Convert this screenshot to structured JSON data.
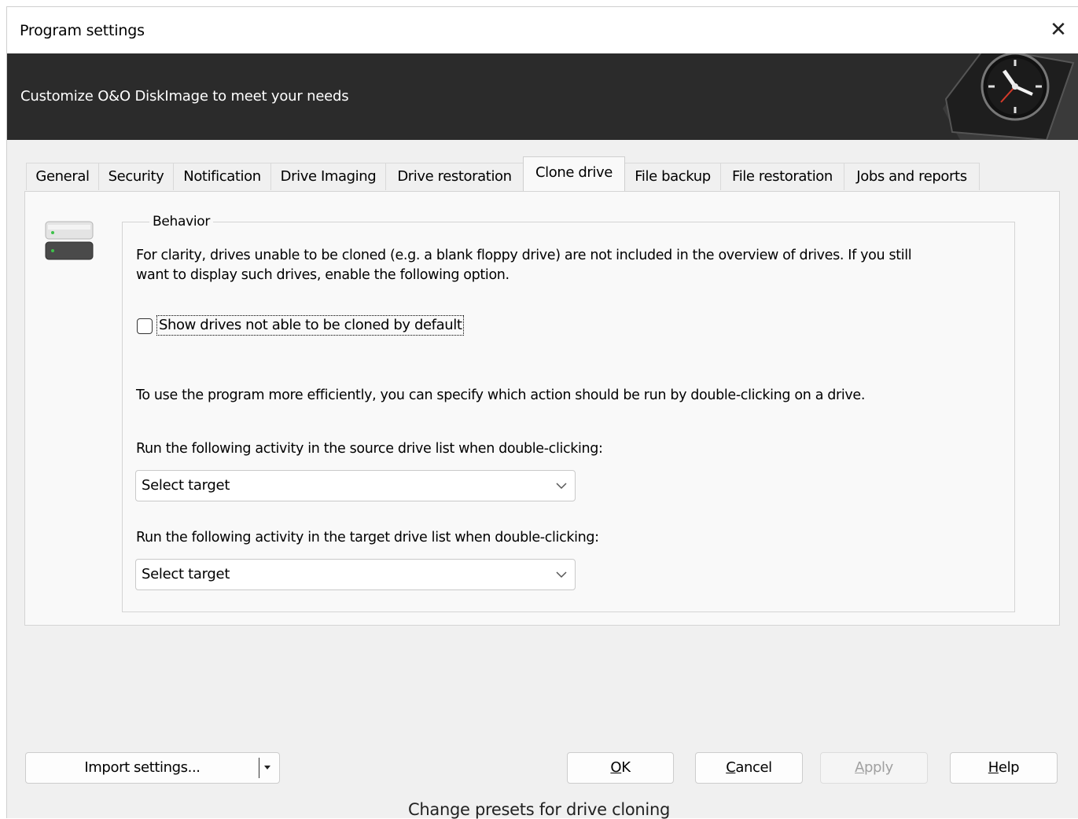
{
  "window": {
    "title": "Program settings",
    "close_glyph": "✕",
    "banner_text": "Customize O&O DiskImage to meet your needs"
  },
  "tabs": [
    {
      "label": "General",
      "active": false
    },
    {
      "label": "Security",
      "active": false
    },
    {
      "label": "Notification",
      "active": false
    },
    {
      "label": "Drive Imaging",
      "active": false
    },
    {
      "label": "Drive restoration",
      "active": false
    },
    {
      "label": "Clone drive",
      "active": true
    },
    {
      "label": "File backup",
      "active": false
    },
    {
      "label": "File restoration",
      "active": false
    },
    {
      "label": "Jobs and reports",
      "active": false
    }
  ],
  "behavior": {
    "legend": "Behavior",
    "info_line1": "For clarity, drives unable to be cloned (e.g. a blank floppy drive) are not included in the overview of drives. If you still",
    "info_line2": "want to display such drives, enable the following option.",
    "checkbox_label": "Show drives not able to be cloned by default",
    "checkbox_checked": false,
    "efficiency_text": "To use the program more efficiently, you can specify which action should be run by double-clicking on a drive.",
    "source_label": "Run the following activity in the source drive list when double-clicking:",
    "source_value": "Select target",
    "target_label": "Run the following activity in the target drive list when double-clicking:",
    "target_value": "Select target"
  },
  "buttons": {
    "import": "Import settings...",
    "ok_mnemonic": "O",
    "ok_rest": "K",
    "cancel_mnemonic": "C",
    "cancel_rest": "ancel",
    "apply_mnemonic": "A",
    "apply_rest": "pply",
    "help_mnemonic": "H",
    "help_rest": "elp"
  },
  "caption": "Change presets for drive cloning",
  "icons": [
    "close-icon",
    "clock-icon",
    "drive-icon",
    "checkbox-icon",
    "chevron-down-icon",
    "dropdown-arrow-icon"
  ],
  "colors": {
    "banner_background": "#2b2b2b",
    "dialog_background": "#f0f0f0",
    "panel_background": "#f9f9f9",
    "disabled_text": "#a0a0a0"
  }
}
